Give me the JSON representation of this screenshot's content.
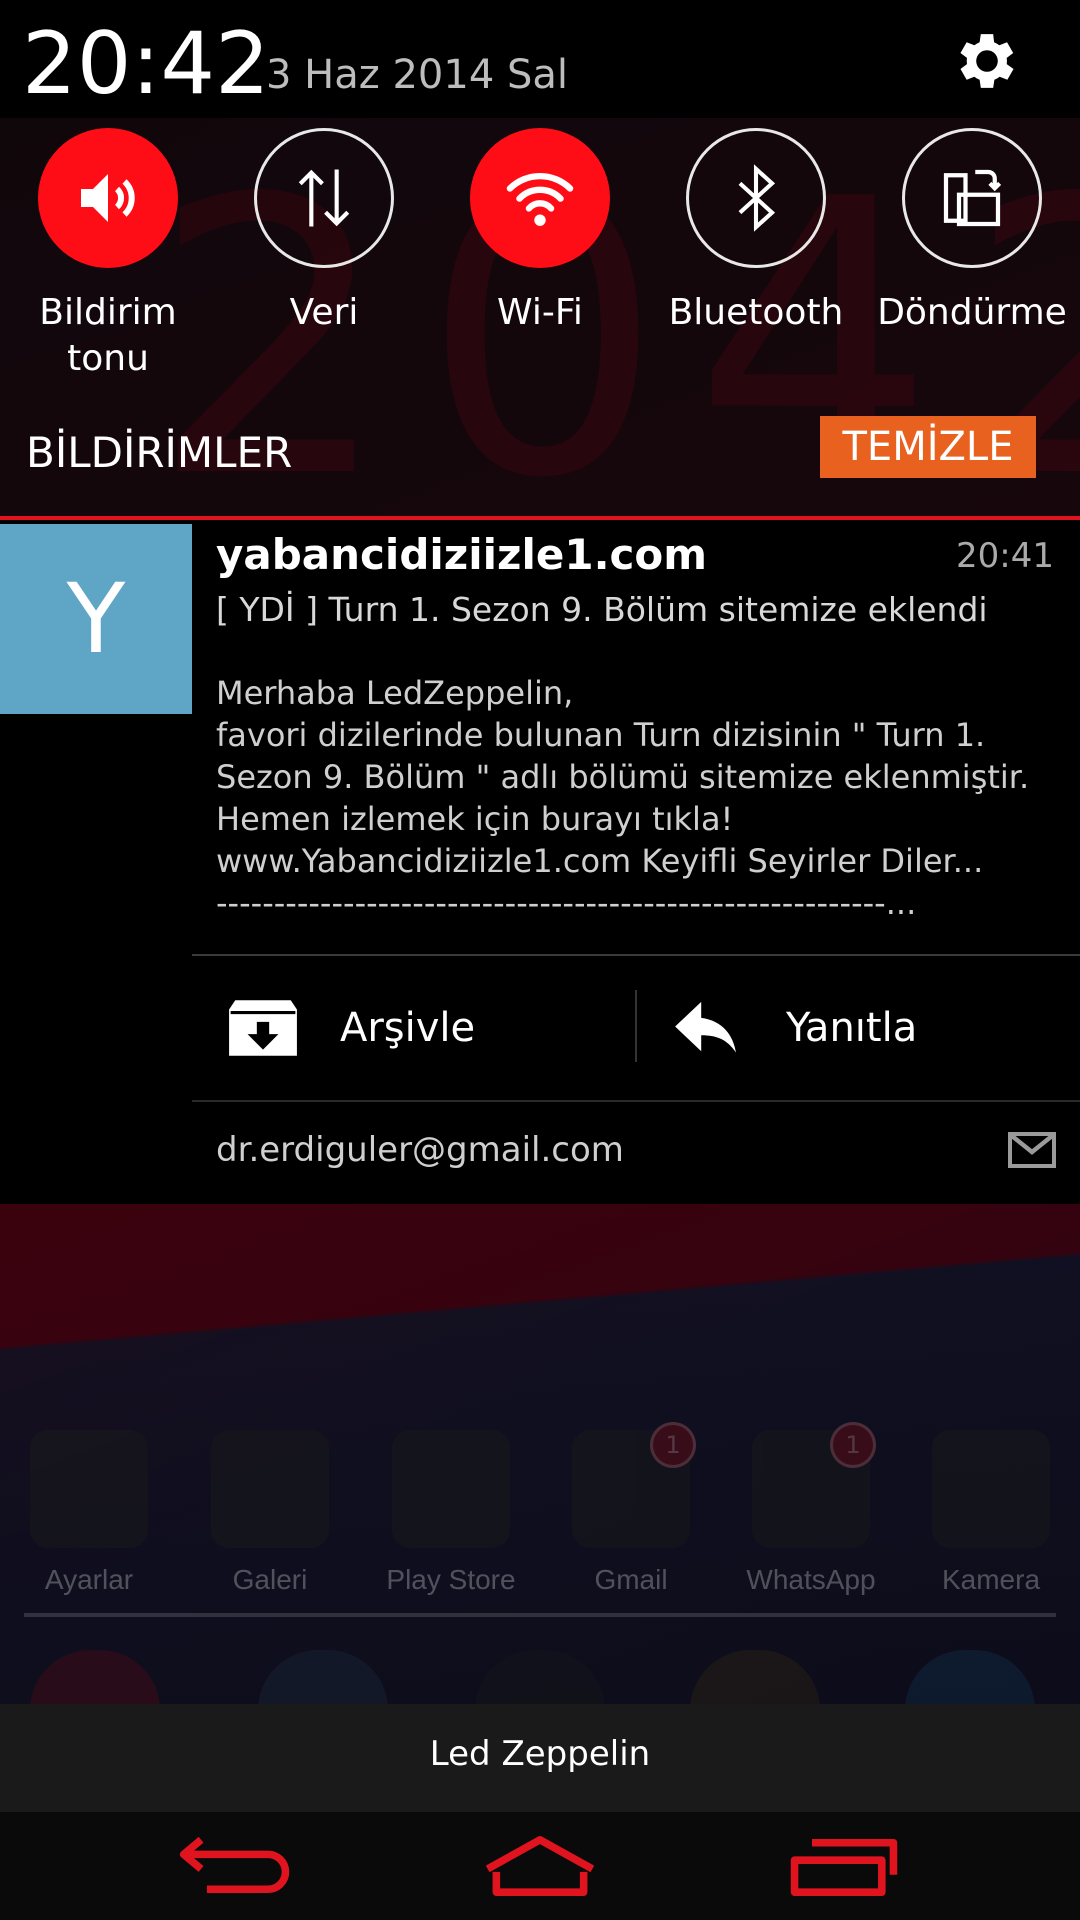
{
  "status": {
    "time": "20:42",
    "date": "3 Haz 2014 Sal"
  },
  "quick_settings": [
    {
      "label": "Bildirim tonu",
      "icon": "speaker-icon",
      "state": "on"
    },
    {
      "label": "Veri",
      "icon": "data-arrows-icon",
      "state": "off"
    },
    {
      "label": "Wi-Fi",
      "icon": "wifi-icon",
      "state": "on"
    },
    {
      "label": "Bluetooth",
      "icon": "bluetooth-icon",
      "state": "off"
    },
    {
      "label": "Döndürme",
      "icon": "rotate-icon",
      "state": "off"
    }
  ],
  "notifications": {
    "title": "BİLDİRİMLER",
    "clear_label": "TEMİZLE"
  },
  "email": {
    "avatar_letter": "Y",
    "sender": "yabancidiziizle1.com",
    "time": "20:41",
    "subject": "[ YDİ ] Turn 1. Sezon 9. Bölüm sitemize eklendi",
    "body_lines": [
      "Merhaba LedZeppelin,",
      "favori dizilerinde bulunan Turn dizisinin \" Turn 1.",
      "Sezon 9. Bölüm \" adlı bölümü sitemize eklenmiştir.",
      "Hemen izlemek için burayı tıkla!",
      "www.Yabancidiziizle1.com Keyifli Seyirler Diler...",
      "----------------------------------------------------------..."
    ],
    "archive_label": "Arşivle",
    "reply_label": "Yanıtla",
    "account": "dr.erdiguler@gmail.com"
  },
  "home_dock": [
    {
      "label": "Ayarlar",
      "badge": ""
    },
    {
      "label": "Galeri",
      "badge": ""
    },
    {
      "label": "Play Store",
      "badge": ""
    },
    {
      "label": "Gmail",
      "badge": "1"
    },
    {
      "label": "WhatsApp",
      "badge": "1"
    },
    {
      "label": "Kamera",
      "badge": ""
    }
  ],
  "music": {
    "now_playing": "Led Zeppelin"
  },
  "colors": {
    "accent_red": "#ff0d17",
    "clear_orange": "#e8611f",
    "avatar_blue": "#5fa5c6",
    "nav_red": "#e0141e"
  }
}
